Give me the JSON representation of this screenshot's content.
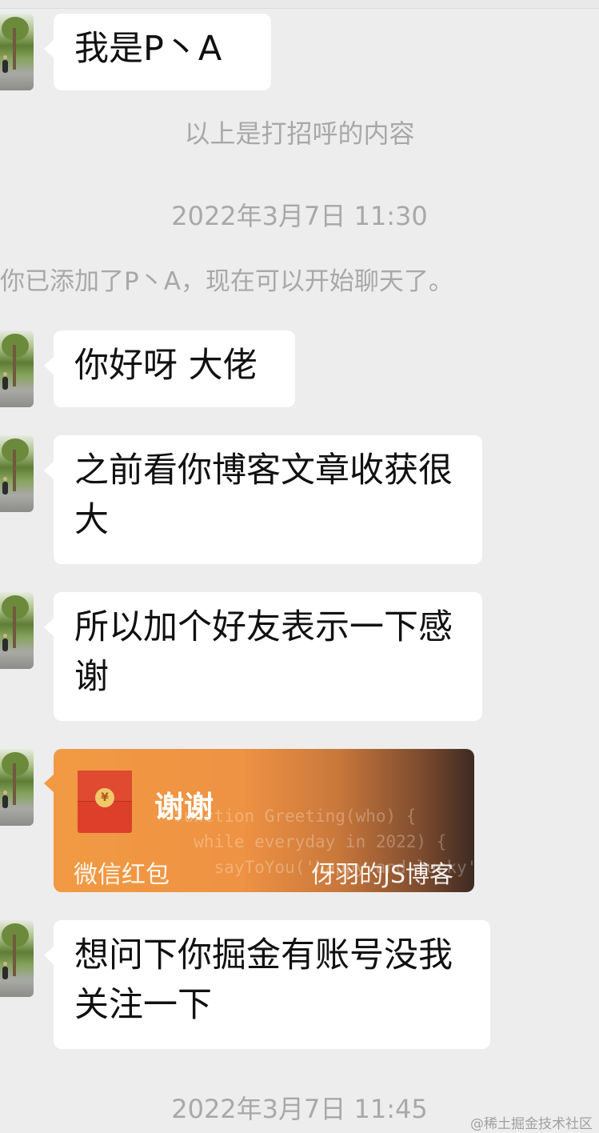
{
  "messages": [
    {
      "text": "我是P丶A"
    },
    {
      "text": "你好呀 大佬"
    },
    {
      "text": "之前看你博客文章收获很大"
    },
    {
      "text": "所以加个好友表示一下感谢"
    },
    {
      "text": "想问下你掘金有账号没我关注一下"
    }
  ],
  "system": {
    "greeting_note": "以上是打招呼的内容",
    "added_note": "你已添加了P丶A，现在可以开始聊天了。"
  },
  "timestamps": [
    "2022年3月7日 11:30",
    "2022年3月7日 11:45"
  ],
  "red_packet": {
    "title": "谢谢",
    "label": "微信红包",
    "cover_name": "伢羽的JS博客",
    "cover_code": "function Greeting(who) {\n  while everyday in 2022) {\n    sayToYou('happy and lucky')",
    "coin_symbol": "¥",
    "color": "#f19a43"
  },
  "watermark": "@稀土掘金技术社区"
}
